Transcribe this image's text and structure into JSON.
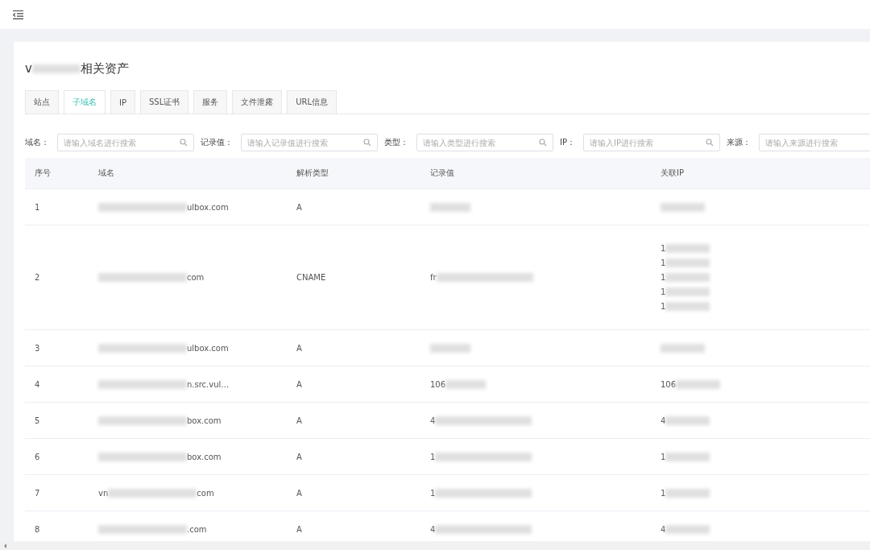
{
  "title": {
    "text": "v",
    "text_end": "相关资产",
    "blur_middle": true
  },
  "tabs": [
    {
      "label": "站点",
      "selected": false
    },
    {
      "label": "子域名",
      "selected": true
    },
    {
      "label": "IP",
      "selected": false
    },
    {
      "label": "SSL证书",
      "selected": false
    },
    {
      "label": "服务",
      "selected": false
    },
    {
      "label": "文件泄露",
      "selected": false
    },
    {
      "label": "URL信息",
      "selected": false
    }
  ],
  "filters": [
    {
      "label": "域名：",
      "placeholder": "请输入域名进行搜索",
      "search_icon": true
    },
    {
      "label": "记录值：",
      "placeholder": "请输入记录值进行搜索",
      "search_icon": true
    },
    {
      "label": "类型：",
      "placeholder": "请输入类型进行搜索",
      "search_icon": true
    },
    {
      "label": "IP：",
      "placeholder": "请输入IP进行搜索",
      "search_icon": true
    },
    {
      "label": "来源：",
      "placeholder": "请输入来源进行搜索",
      "search_icon": false
    }
  ],
  "table": {
    "columns": [
      "序号",
      "域名",
      "解析类型",
      "记录值",
      "关联IP"
    ],
    "rows": [
      {
        "index": "1",
        "domain": {
          "text": "ulbox.com",
          "blur_before": true
        },
        "type": "A",
        "record": {
          "blur_before": true
        },
        "ips": [
          {
            "blur_before": true
          }
        ]
      },
      {
        "index": "2",
        "domain": {
          "text": "com",
          "blur_before": true
        },
        "type": "CNAME",
        "record": {
          "text": "fr",
          "blur_after": true
        },
        "ips": [
          {
            "text": "1",
            "blur_after": true
          },
          {
            "text": "1",
            "blur_after": true
          },
          {
            "text": "1",
            "blur_after": true
          },
          {
            "text": "1",
            "blur_after": true
          },
          {
            "text": "1",
            "blur_after": true
          }
        ]
      },
      {
        "index": "3",
        "domain": {
          "text": "ulbox.com",
          "blur_before": true
        },
        "type": "A",
        "record": {
          "blur_before": true
        },
        "ips": [
          {
            "blur_before": true
          }
        ]
      },
      {
        "index": "4",
        "domain": {
          "text": "n.src.vul…",
          "blur_before": true
        },
        "type": "A",
        "record": {
          "text": "106",
          "blur_after": true
        },
        "ips": [
          {
            "text": "106",
            "blur_after": true
          }
        ]
      },
      {
        "index": "5",
        "domain": {
          "text": "box.com",
          "blur_before": true
        },
        "type": "A",
        "record": {
          "text": "4",
          "blur_after": true
        },
        "ips": [
          {
            "text": "4",
            "blur_after": true
          }
        ]
      },
      {
        "index": "6",
        "domain": {
          "text": "box.com",
          "blur_before": true
        },
        "type": "A",
        "record": {
          "text": "1",
          "blur_after": true
        },
        "ips": [
          {
            "text": "1",
            "blur_after": true
          }
        ]
      },
      {
        "index": "7",
        "domain": {
          "text": "vn",
          "text_end": "com",
          "blur_middle": true
        },
        "type": "A",
        "record": {
          "text": "1",
          "blur_after": true
        },
        "ips": [
          {
            "text": "1",
            "blur_after": true
          }
        ]
      },
      {
        "index": "8",
        "domain": {
          "text": ".com",
          "blur_before": true
        },
        "type": "A",
        "record": {
          "text": "4",
          "blur_after": true
        },
        "ips": [
          {
            "text": "4",
            "blur_after": true
          }
        ]
      }
    ]
  }
}
